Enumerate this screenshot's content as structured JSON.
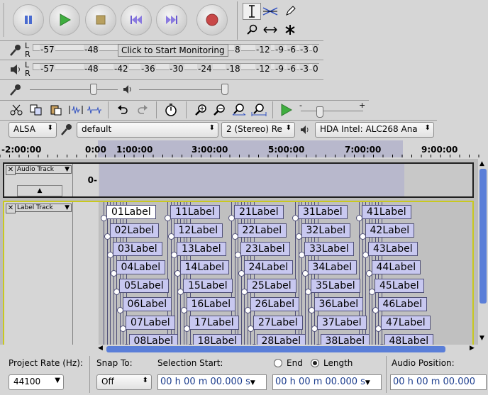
{
  "transport": {
    "pause_icon": "pause-icon",
    "play_icon": "play-icon",
    "stop_icon": "stop-icon",
    "skip_start_icon": "skip-to-start-icon",
    "skip_end_icon": "skip-to-end-icon",
    "record_icon": "record-icon"
  },
  "tools": [
    "selection-tool",
    "envelope-tool",
    "draw-tool",
    "zoom-tool",
    "timeshift-tool",
    "multi-tool"
  ],
  "meters": {
    "record": {
      "l": "L",
      "r": "R",
      "ticks": [
        "-57",
        "-48",
        "8",
        "-12",
        "-9",
        "-6",
        "-3",
        "0"
      ],
      "tooltip": "Click to Start Monitoring"
    },
    "play": {
      "l": "L",
      "r": "R",
      "ticks": [
        "-57",
        "-48",
        "-42",
        "-36",
        "-30",
        "-24",
        "-18",
        "-12",
        "-9",
        "-6",
        "-3",
        "0"
      ]
    }
  },
  "mixer": {
    "record_volume": 0.73,
    "playback_volume": 1.0
  },
  "play_speed": {
    "minus": "-",
    "plus": "+"
  },
  "device": {
    "host": "ALSA",
    "record_device": "default",
    "channels": "2 (Stereo) Re",
    "playback_device": "HDA Intel: ALC268 Ana"
  },
  "ruler": {
    "ticks": [
      "-2:00:00",
      "0:00",
      "1:00:00",
      "3:00:00",
      "5:00:00",
      "7:00:00",
      "9:00:00"
    ]
  },
  "audio_track": {
    "name": "Audio Track",
    "scale": "0-"
  },
  "label_track": {
    "name": "Label Track",
    "labels": [
      "01Label",
      "02Label",
      "03Label",
      "04Label",
      "05Label",
      "06Label",
      "07Label",
      "08Label",
      "11Label",
      "12Label",
      "13Label",
      "14Label",
      "15Label",
      "16Label",
      "17Label",
      "18Label",
      "21Label",
      "22Label",
      "23Label",
      "24Label",
      "25Label",
      "26Label",
      "27Label",
      "28Label",
      "31Label",
      "32Label",
      "33Label",
      "34Label",
      "35Label",
      "36Label",
      "37Label",
      "38Label",
      "41Label",
      "42Label",
      "43Label",
      "44Label",
      "45Label",
      "46Label",
      "47Label",
      "48Label"
    ]
  },
  "status": {
    "project_rate_label": "Project Rate (Hz):",
    "project_rate": "44100",
    "snap_label": "Snap To:",
    "snap_value": "Off",
    "selection_start_label": "Selection Start:",
    "end_label": "End",
    "length_label": "Length",
    "audio_position_label": "Audio Position:",
    "selection_start": "00 h 00 m 00.000 s",
    "selection_length": "00 h 00 m 00.000 s",
    "audio_position": "00 h 00 m 00.000"
  }
}
